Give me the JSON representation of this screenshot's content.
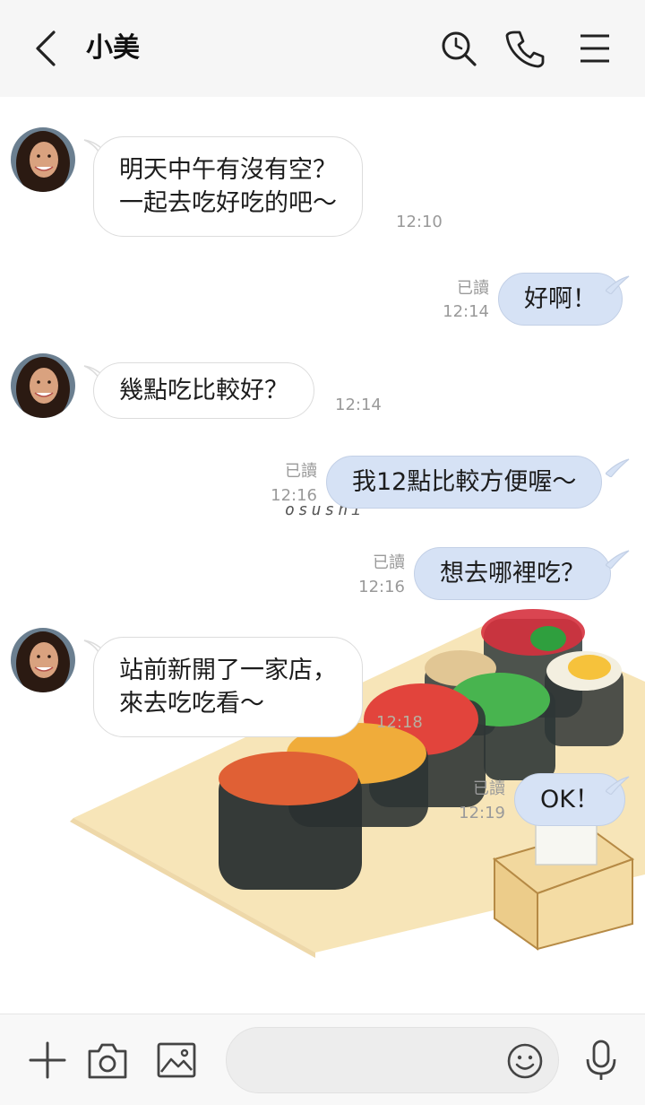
{
  "header": {
    "contact_name": "小美",
    "icons": [
      "back-arrow-icon",
      "search-history-icon",
      "phone-icon",
      "menu-icon"
    ]
  },
  "background": {
    "signature": "osushi"
  },
  "messages": [
    {
      "side": "in",
      "lines": [
        "明天中午有沒有空？",
        "一起去吃好吃的吧～"
      ],
      "time": "12:10"
    },
    {
      "side": "out",
      "text": "好啊！",
      "read": "已讀",
      "time": "12:14"
    },
    {
      "side": "in",
      "lines": [
        "幾點吃比較好？"
      ],
      "time": "12:14"
    },
    {
      "side": "out",
      "text": "我12點比較方便喔～",
      "read": "已讀",
      "time": "12:16"
    },
    {
      "side": "out",
      "text": "想去哪裡吃？",
      "read": "已讀",
      "time": "12:16"
    },
    {
      "side": "in",
      "lines": [
        "站前新開了一家店，",
        "來去吃吃看～"
      ],
      "time": "12:18"
    },
    {
      "side": "out",
      "text": "OK！",
      "read": "已讀",
      "time": "12:19"
    }
  ],
  "input": {
    "value": "",
    "placeholder": "",
    "icons": [
      "plus-icon",
      "camera-icon",
      "image-icon",
      "emoji-icon",
      "microphone-icon"
    ]
  },
  "colors": {
    "header_bg": "#f6f6f6",
    "outgoing_bubble": "#d6e2f5",
    "incoming_bubble": "#ffffff",
    "meta_text": "#9a9a9a"
  }
}
